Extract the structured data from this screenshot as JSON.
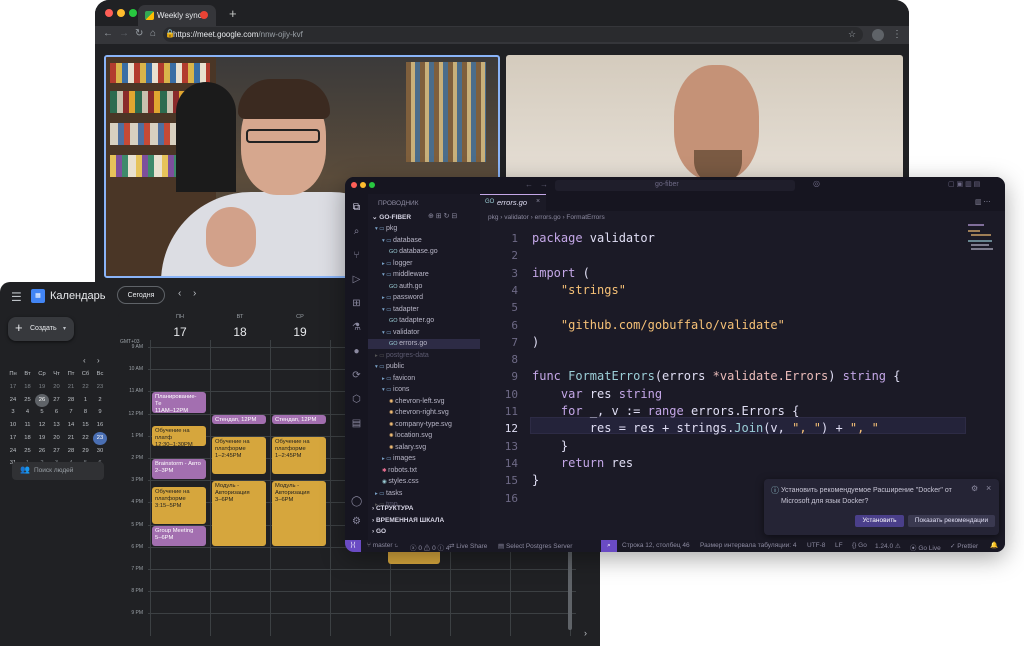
{
  "browser": {
    "tab_title": "Weekly sync",
    "new_tab": "+",
    "url_host": "https://meet.google.com",
    "url_path": "/nnw-ojiy-kvf"
  },
  "vscode": {
    "explorer_title": "ПРОВОДНИК",
    "search_label": "go-fiber",
    "root": "GO-FIBER",
    "tree": [
      {
        "label": "pkg",
        "depth": 1,
        "kind": "folder-open"
      },
      {
        "label": "database",
        "depth": 2,
        "kind": "folder-open"
      },
      {
        "label": "database.go",
        "depth": 3,
        "kind": "go"
      },
      {
        "label": "logger",
        "depth": 2,
        "kind": "folder"
      },
      {
        "label": "middleware",
        "depth": 2,
        "kind": "folder-open"
      },
      {
        "label": "auth.go",
        "depth": 3,
        "kind": "go"
      },
      {
        "label": "password",
        "depth": 2,
        "kind": "folder"
      },
      {
        "label": "tadapter",
        "depth": 2,
        "kind": "folder-open"
      },
      {
        "label": "tadapter.go",
        "depth": 3,
        "kind": "go"
      },
      {
        "label": "validator",
        "depth": 2,
        "kind": "folder-open"
      },
      {
        "label": "errors.go",
        "depth": 3,
        "kind": "go",
        "selected": true
      },
      {
        "label": "postgres-data",
        "depth": 1,
        "kind": "folder-dim"
      },
      {
        "label": "public",
        "depth": 1,
        "kind": "folder-open"
      },
      {
        "label": "favicon",
        "depth": 2,
        "kind": "folder"
      },
      {
        "label": "icons",
        "depth": 2,
        "kind": "folder-open"
      },
      {
        "label": "chevron-left.svg",
        "depth": 3,
        "kind": "svg"
      },
      {
        "label": "chevron-right.svg",
        "depth": 3,
        "kind": "svg"
      },
      {
        "label": "company-type.svg",
        "depth": 3,
        "kind": "svg"
      },
      {
        "label": "location.svg",
        "depth": 3,
        "kind": "svg"
      },
      {
        "label": "salary.svg",
        "depth": 3,
        "kind": "svg"
      },
      {
        "label": "images",
        "depth": 2,
        "kind": "folder"
      },
      {
        "label": "robots.txt",
        "depth": 2,
        "kind": "txt"
      },
      {
        "label": "styles.css",
        "depth": 2,
        "kind": "css"
      },
      {
        "label": "tasks",
        "depth": 1,
        "kind": "folder"
      },
      {
        "label": "tmp",
        "depth": 1,
        "kind": "folder-dim"
      }
    ],
    "sections": [
      "СТРУКТУРА",
      "ВРЕМЕННАЯ ШКАЛА",
      "GO"
    ],
    "active_tab": "errors.go",
    "breadcrumb": [
      "pkg",
      "validator",
      "errors.go",
      "FormatErrors"
    ],
    "line_numbers": [
      "1",
      "2",
      "3",
      "4",
      "5",
      "6",
      "7",
      "8",
      "9",
      "10",
      "11",
      "12",
      "13",
      "14",
      "15",
      "16"
    ],
    "code": [
      [
        [
          "package ",
          "kw"
        ],
        [
          "validator",
          "plain"
        ]
      ],
      [],
      [
        [
          "import ",
          "kw"
        ],
        [
          "(",
          "plain"
        ]
      ],
      [
        [
          "    ",
          "plain"
        ],
        [
          "\"strings\"",
          "str"
        ]
      ],
      [],
      [
        [
          "    ",
          "plain"
        ],
        [
          "\"github.com/gobuffalo/validate\"",
          "str"
        ]
      ],
      [
        [
          ")",
          "plain"
        ]
      ],
      [],
      [
        [
          "func ",
          "kw"
        ],
        [
          "FormatErrors",
          "fn"
        ],
        [
          "(errors ",
          "plain"
        ],
        [
          "*validate.Errors",
          "ty"
        ],
        [
          ") ",
          "plain"
        ],
        [
          "string",
          "kw"
        ],
        [
          " {",
          "plain"
        ]
      ],
      [
        [
          "    ",
          "plain"
        ],
        [
          "var ",
          "kw"
        ],
        [
          "res ",
          "plain"
        ],
        [
          "string",
          "kw"
        ]
      ],
      [
        [
          "    ",
          "plain"
        ],
        [
          "for ",
          "kw"
        ],
        [
          "_, v := ",
          "plain"
        ],
        [
          "range ",
          "kw"
        ],
        [
          "errors.Errors {",
          "plain"
        ]
      ],
      [
        [
          "        ",
          "plain"
        ],
        [
          "res = res + strings.",
          "plain"
        ],
        [
          "Join",
          "fn"
        ],
        [
          "(v, ",
          "plain"
        ],
        [
          "\", \"",
          "str"
        ],
        [
          ") + ",
          "plain"
        ],
        [
          "\", \"",
          "str"
        ]
      ],
      [
        [
          "    ",
          "plain"
        ],
        [
          "}",
          "plain"
        ]
      ],
      [
        [
          "    ",
          "plain"
        ],
        [
          "return ",
          "kw"
        ],
        [
          "res",
          "plain"
        ]
      ],
      [
        [
          "}",
          "plain"
        ]
      ],
      []
    ],
    "notification": {
      "text": "Установить рекомендуемое Расширение \"Docker\" от Microsoft для язык Docker?",
      "install": "Установить",
      "show": "Показать рекомендации"
    },
    "status": {
      "branch": "master",
      "problems": "0",
      "warnings": "0",
      "info": "4",
      "live_share": "Live Share",
      "postgres": "Select Postgres Server",
      "position": "Строка 12, столбец 46",
      "indent": "Размер интервала табуляции: 4",
      "encoding": "UTF-8",
      "eol": "LF",
      "lang": "Go",
      "version": "1.24.0",
      "go_live": "Go Live",
      "prettier": "Prettier"
    }
  },
  "calendar": {
    "app_name": "Календарь",
    "today_button": "Сегодня",
    "create_button": "Создать",
    "search_people": "Поиск людей",
    "timezone": "GMT+03",
    "days": [
      {
        "name": "ПН",
        "num": "17"
      },
      {
        "name": "ВТ",
        "num": "18"
      },
      {
        "name": "СР",
        "num": "19"
      }
    ],
    "hours": [
      "9 AM",
      "10 AM",
      "11 AM",
      "12 PM",
      "1 PM",
      "2 PM",
      "3 PM",
      "4 PM",
      "5 PM",
      "6 PM",
      "7 PM",
      "8 PM",
      "9 PM"
    ],
    "mini_weekdays": [
      "Пн",
      "Вт",
      "Ср",
      "Чт",
      "Пт",
      "Сб",
      "Вс"
    ],
    "mini_days": [
      [
        "17",
        "18",
        "19",
        "20",
        "21",
        "22",
        "23"
      ],
      [
        "24",
        "25",
        "26",
        "27",
        "28",
        "1",
        "2"
      ],
      [
        "3",
        "4",
        "5",
        "6",
        "7",
        "8",
        "9"
      ],
      [
        "10",
        "11",
        "12",
        "13",
        "14",
        "15",
        "16"
      ],
      [
        "17",
        "18",
        "19",
        "20",
        "21",
        "22",
        "23"
      ],
      [
        "24",
        "25",
        "26",
        "27",
        "28",
        "29",
        "30"
      ],
      [
        "31",
        "1",
        "2",
        "3",
        "4",
        "5",
        "6"
      ]
    ],
    "events": [
      {
        "title": "Планирование- Те",
        "time": "11AM–12PM",
        "col": 0,
        "start": 11.0,
        "end": 12.0,
        "color": "purple"
      },
      {
        "title": "Обучение на платф",
        "time": "12:30–1:30PM",
        "col": 0,
        "start": 12.5,
        "end": 13.5,
        "color": "yellow"
      },
      {
        "title": "Brainstorm - Авто",
        "time": "2–3PM",
        "col": 0,
        "start": 14.0,
        "end": 15.0,
        "color": "purple"
      },
      {
        "title": "Обучение на платформе",
        "time": "3:15–5PM",
        "col": 0,
        "start": 15.25,
        "end": 17.0,
        "color": "yellow"
      },
      {
        "title": "Group Meeting",
        "time": "5–6PM",
        "col": 0,
        "start": 17.0,
        "end": 18.0,
        "color": "purple"
      },
      {
        "title": "Стендап, 12PM",
        "time": "",
        "col": 1,
        "start": 12.0,
        "end": 12.5,
        "color": "purple"
      },
      {
        "title": "Обучение на платформе",
        "time": "1–2:45PM",
        "col": 1,
        "start": 13.0,
        "end": 14.75,
        "color": "yellow"
      },
      {
        "title": "Модуль - Авторизация",
        "time": "3–6PM",
        "col": 1,
        "start": 15.0,
        "end": 18.0,
        "color": "yellow"
      },
      {
        "title": "Стендап, 12PM",
        "time": "",
        "col": 2,
        "start": 12.0,
        "end": 12.5,
        "color": "purple"
      },
      {
        "title": "Обучение на платформе",
        "time": "1–2:45PM",
        "col": 2,
        "start": 13.0,
        "end": 14.75,
        "color": "yellow"
      },
      {
        "title": "Модуль - Авторизация",
        "time": "3–6PM",
        "col": 2,
        "start": 15.0,
        "end": 18.0,
        "color": "yellow"
      }
    ]
  }
}
